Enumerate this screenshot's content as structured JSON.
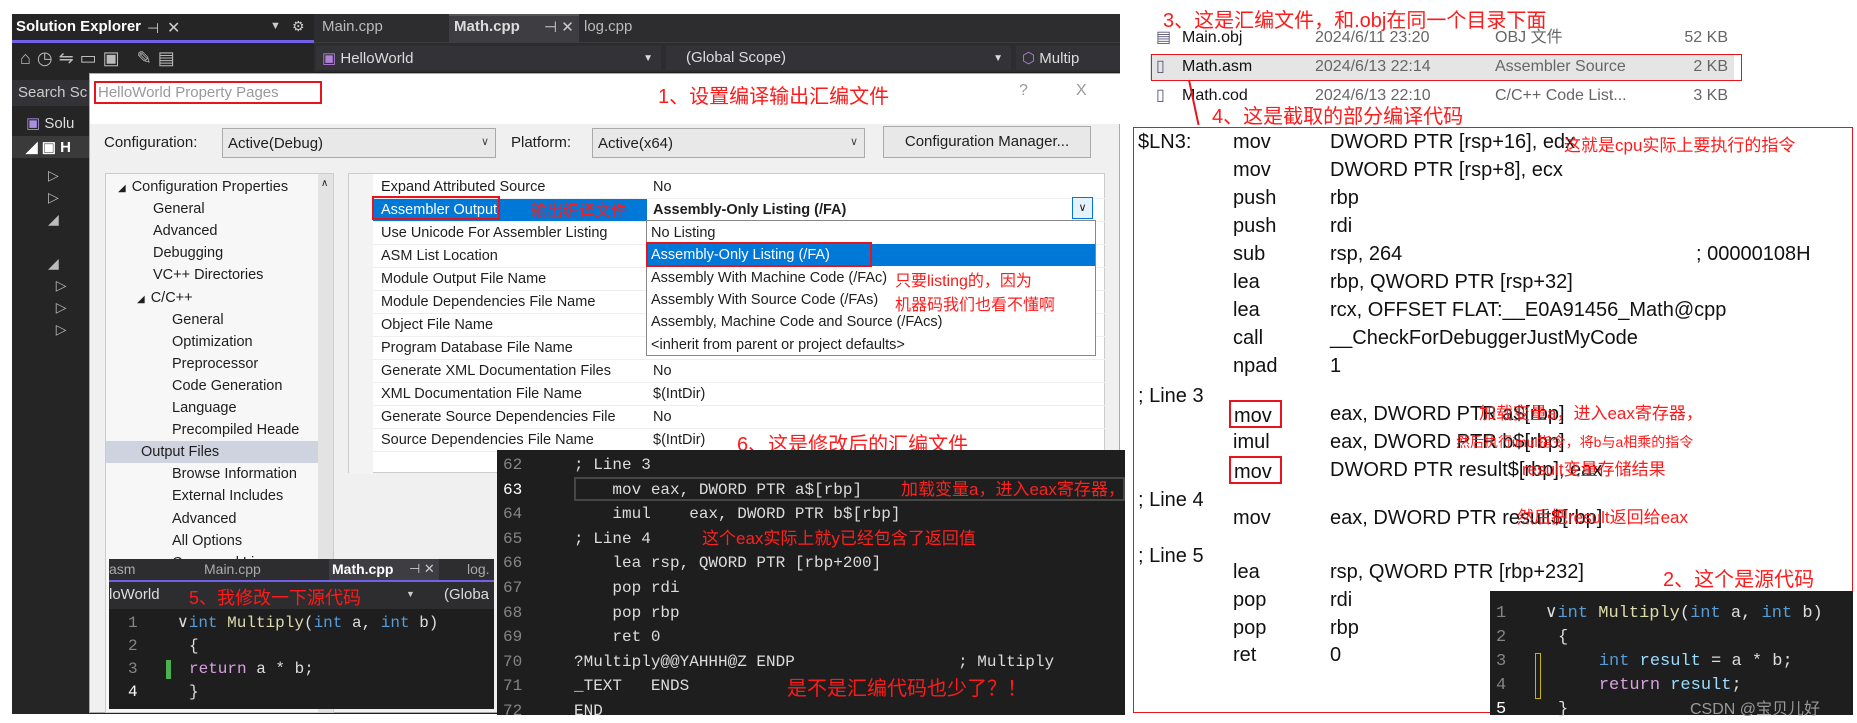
{
  "colors": {
    "accent": "#0078d7",
    "annotation": "#ff1a1a",
    "editor_bg": "#1e1e1e"
  },
  "solution_explorer": {
    "title": "Solution Explorer",
    "search": "Search Sc",
    "tree_root": "Solu",
    "project": "H"
  },
  "editor_tabs": [
    {
      "label": "Main.cpp"
    },
    {
      "label": "Math.cpp",
      "active": true
    },
    {
      "label": "log.cpp"
    }
  ],
  "editor_toolbar": {
    "project": "HelloWorld",
    "scope": "(Global Scope)",
    "member": "Multip"
  },
  "dialog": {
    "title": "HelloWorld Property Pages",
    "help": "?",
    "close": "X",
    "config_label": "Configuration:",
    "config_value": "Active(Debug)",
    "platform_label": "Platform:",
    "platform_value": "Active(x64)",
    "config_manager": "Configuration Manager...",
    "tree": [
      {
        "label": "Configuration Properties",
        "level": 0,
        "expanded": true
      },
      {
        "label": "General",
        "level": 1
      },
      {
        "label": "Advanced",
        "level": 1
      },
      {
        "label": "Debugging",
        "level": 1
      },
      {
        "label": "VC++ Directories",
        "level": 1
      },
      {
        "label": "C/C++",
        "level": 1,
        "expanded": true
      },
      {
        "label": "General",
        "level": 2
      },
      {
        "label": "Optimization",
        "level": 2
      },
      {
        "label": "Preprocessor",
        "level": 2
      },
      {
        "label": "Code Generation",
        "level": 2
      },
      {
        "label": "Language",
        "level": 2
      },
      {
        "label": "Precompiled Heade",
        "level": 2
      },
      {
        "label": "Output Files",
        "level": 2,
        "selected": true
      },
      {
        "label": "Browse Information",
        "level": 2
      },
      {
        "label": "External Includes",
        "level": 2
      },
      {
        "label": "Advanced",
        "level": 2
      },
      {
        "label": "All Options",
        "level": 2
      },
      {
        "label": "Command Line",
        "level": 2
      }
    ],
    "properties": [
      {
        "name": "Expand Attributed Source",
        "value": "No"
      },
      {
        "name": "Assembler Output",
        "value": "Assembly-Only Listing (/FA)",
        "selected": true
      },
      {
        "name": "Use Unicode For Assembler Listing",
        "value": ""
      },
      {
        "name": "ASM List Location",
        "value": ""
      },
      {
        "name": "Module Output File Name",
        "value": ""
      },
      {
        "name": "Module Dependencies File Name",
        "value": ""
      },
      {
        "name": "Object File Name",
        "value": ""
      },
      {
        "name": "Program Database File Name",
        "value": ""
      },
      {
        "name": "Generate XML Documentation Files",
        "value": "No"
      },
      {
        "name": "XML Documentation File Name",
        "value": "$(IntDir)"
      },
      {
        "name": "Generate Source Dependencies File",
        "value": "No"
      },
      {
        "name": "Source Dependencies File Name",
        "value": "$(IntDir)"
      }
    ],
    "dropdown_options": [
      {
        "label": "No Listing"
      },
      {
        "label": "Assembly-Only Listing (/FA)",
        "selected": true
      },
      {
        "label": "Assembly With Machine Code (/FAc)"
      },
      {
        "label": "Assembly With Source Code (/FAs)"
      },
      {
        "label": "Assembly, Machine Code and Source (/FAcs)"
      },
      {
        "label": "<inherit from parent or project defaults>"
      }
    ]
  },
  "annotations": {
    "a1": "1、设置编译输出汇编文件",
    "a_output": "输出编译文件",
    "a_listing1": "只要listing的，因为",
    "a_listing2": "机器码我们也看不懂啊",
    "a2": "2、这个是源代码",
    "a3": "3、这是汇编文件，和.obj在同一个目录下面",
    "a4": "4、这是截取的部分编译代码",
    "a5": "5、我修改一下源代码",
    "a6": "6、这是修改后的汇编文件",
    "a_less": "是不是汇编代码也少了？！",
    "watermark": "CSDN @宝贝儿好"
  },
  "asm_editor": [
    {
      "num": "62",
      "code": "; Line 3"
    },
    {
      "num": "63",
      "code": "    mov eax, DWORD PTR a$[rbp]",
      "ann": "加载变量a，进入eax寄存器，"
    },
    {
      "num": "64",
      "code": "    imul    eax, DWORD PTR b$[rbp]"
    },
    {
      "num": "65",
      "code": "; Line 4",
      "ann": "这个eax实际上就y已经包含了返回值"
    },
    {
      "num": "66",
      "code": "    lea rsp, QWORD PTR [rbp+200]"
    },
    {
      "num": "67",
      "code": "    pop rdi"
    },
    {
      "num": "68",
      "code": "    pop rbp"
    },
    {
      "num": "69",
      "code": "    ret 0"
    },
    {
      "num": "70",
      "code": "?Multiply@@YAHHH@Z ENDP                 ; Multiply"
    },
    {
      "num": "71",
      "code": "_TEXT   ENDS"
    },
    {
      "num": "72",
      "code": "END"
    }
  ],
  "small_editor": {
    "tabs": [
      "asm",
      "Main.cpp",
      "Math.cpp",
      "log."
    ],
    "project": "loWorld",
    "scope": "(Globa",
    "lines": [
      "1",
      "2",
      "3",
      "4"
    ]
  },
  "files": [
    {
      "name": "Main.obj",
      "date": "2024/6/11 23:20",
      "type": "OBJ 文件",
      "size": "52 KB"
    },
    {
      "name": "Math.asm",
      "date": "2024/6/13 22:14",
      "type": "Assembler Source",
      "size": "2 KB",
      "selected": true
    },
    {
      "name": "Math.cod",
      "date": "2024/6/13 22:10",
      "type": "C/C++ Code List...",
      "size": "3 KB"
    }
  ],
  "asm_listing": [
    {
      "label": "$LN3:",
      "op": "mov",
      "args": "DWORD PTR [rsp+16], edx",
      "ann": "这就是cpu实际上要执行的指令"
    },
    {
      "op": "mov",
      "args": "DWORD PTR [rsp+8], ecx"
    },
    {
      "op": "push",
      "args": "rbp"
    },
    {
      "op": "push",
      "args": "rdi"
    },
    {
      "op": "sub",
      "args": "rsp, 264",
      "comment": "; 00000108H"
    },
    {
      "op": "lea",
      "args": "rbp, QWORD PTR [rsp+32]"
    },
    {
      "op": "lea",
      "args": "rcx, OFFSET FLAT:__E0A91456_Math@cpp"
    },
    {
      "op": "call",
      "args": "__CheckForDebuggerJustMyCode"
    },
    {
      "op": "npad",
      "args": "1"
    },
    {
      "label": "; Line 3"
    },
    {
      "op": "mov",
      "args": "eax, DWORD PTR a$[rbp]",
      "ann": "加载变量a，进入eax寄存器，",
      "boxed": true
    },
    {
      "op": "imul",
      "args": "eax, DWORD PTR b$[rbp]",
      "ann": "然后执行imul指令，将b与a相乘的指令"
    },
    {
      "op": "mov",
      "args": "DWORD PTR result$[rbp], eax",
      "ann": "result变量存储结果",
      "boxed": true
    },
    {
      "label": "; Line 4"
    },
    {
      "op": "mov",
      "args": "eax, DWORD PTR result$[rbp]",
      "ann": "然后把result返回给eax"
    },
    {
      "label": "; Line 5"
    },
    {
      "op": "lea",
      "args": "rsp, QWORD PTR [rbp+232]"
    },
    {
      "op": "pop",
      "args": "rdi"
    },
    {
      "op": "pop",
      "args": "rbp"
    },
    {
      "op": "ret",
      "args": "0"
    }
  ],
  "source_editor": {
    "lines": [
      "1",
      "2",
      "3",
      "4",
      "5"
    ]
  }
}
